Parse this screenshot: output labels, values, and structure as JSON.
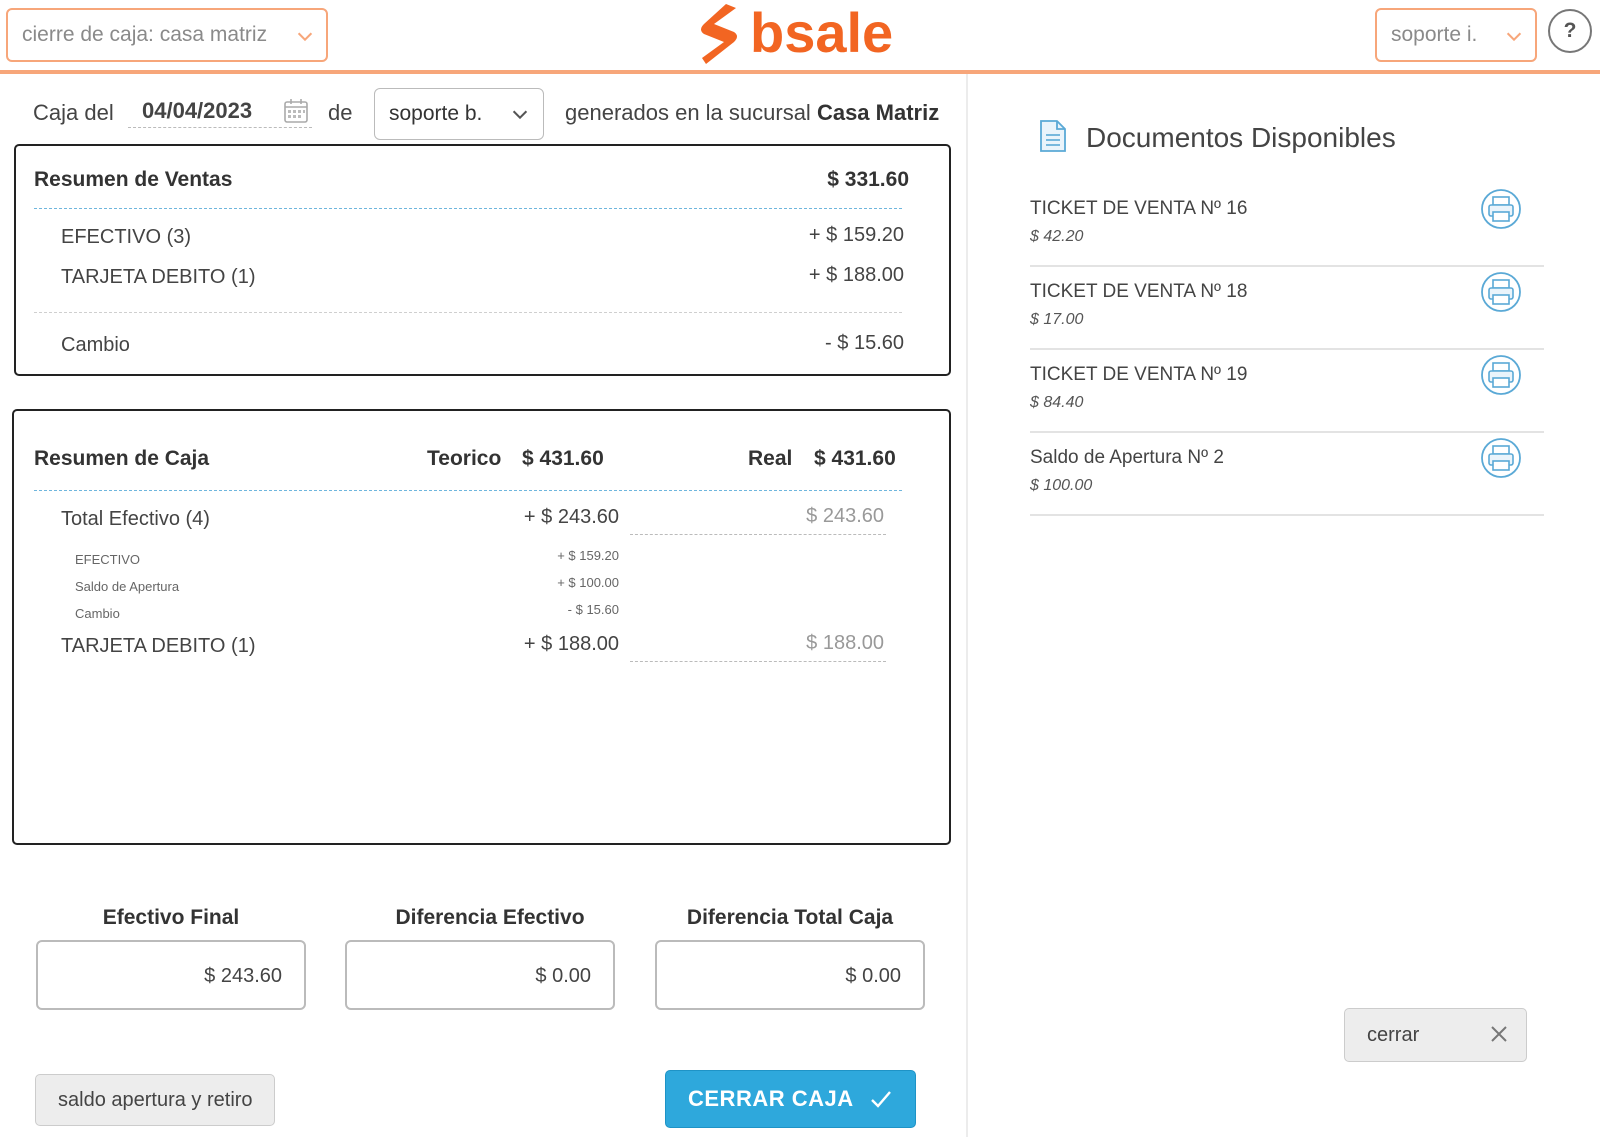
{
  "header": {
    "branch_select": "cierre de caja: casa matriz",
    "logo_text": "bsale",
    "user_select": "soporte i.",
    "help_label": "?"
  },
  "caja_row": {
    "caja_label": "Caja del",
    "date": "04/04/2023",
    "de_label": "de",
    "seller": "soporte b.",
    "generated_label": "generados en la sucursal",
    "branch_name": "Casa Matriz"
  },
  "ventas": {
    "title": "Resumen de Ventas",
    "total": "$ 331.60",
    "rows": [
      {
        "label": "EFECTIVO (3)",
        "value": "+ $ 159.20"
      },
      {
        "label": "TARJETA DEBITO (1)",
        "value": "+ $ 188.00"
      }
    ],
    "cambio": {
      "label": "Cambio",
      "value": "- $ 15.60"
    }
  },
  "caja": {
    "title": "Resumen de Caja",
    "teorico_label": "Teorico",
    "teorico_value": "$ 431.60",
    "real_label": "Real",
    "real_value": "$ 431.60",
    "total_efectivo": {
      "label": "Total Efectivo (4)",
      "value": "+ $ 243.60",
      "real": "$ 243.60"
    },
    "sub_rows": [
      {
        "label": "EFECTIVO",
        "value": "+ $ 159.20"
      },
      {
        "label": "Saldo de Apertura",
        "value": "+ $ 100.00"
      },
      {
        "label": "Cambio",
        "value": "- $ 15.60"
      }
    ],
    "tarjeta": {
      "label": "TARJETA DEBITO (1)",
      "value": "+ $ 188.00",
      "real": "$ 188.00"
    }
  },
  "summary": {
    "efectivo_final_label": "Efectivo Final",
    "efectivo_final_value": "$ 243.60",
    "diferencia_efectivo_label": "Diferencia Efectivo",
    "diferencia_efectivo_value": "$ 0.00",
    "diferencia_total_label": "Diferencia Total Caja",
    "diferencia_total_value": "$ 0.00"
  },
  "buttons": {
    "saldo_apertura": "saldo apertura y retiro",
    "cerrar_caja": "CERRAR CAJA",
    "cerrar": "cerrar"
  },
  "documents": {
    "title": "Documentos Disponibles",
    "items": [
      {
        "name": "TICKET DE VENTA Nº 16",
        "amount": "$ 42.20"
      },
      {
        "name": "TICKET DE VENTA Nº 18",
        "amount": "$ 17.00"
      },
      {
        "name": "TICKET DE VENTA Nº 19",
        "amount": "$ 84.40"
      },
      {
        "name": "Saldo de Apertura Nº 2",
        "amount": "$ 100.00"
      }
    ]
  },
  "colors": {
    "brand_orange": "#f26522",
    "accent_border": "#f7a67a",
    "primary_blue": "#2ea8dc",
    "icon_blue": "#5aa9d6"
  }
}
